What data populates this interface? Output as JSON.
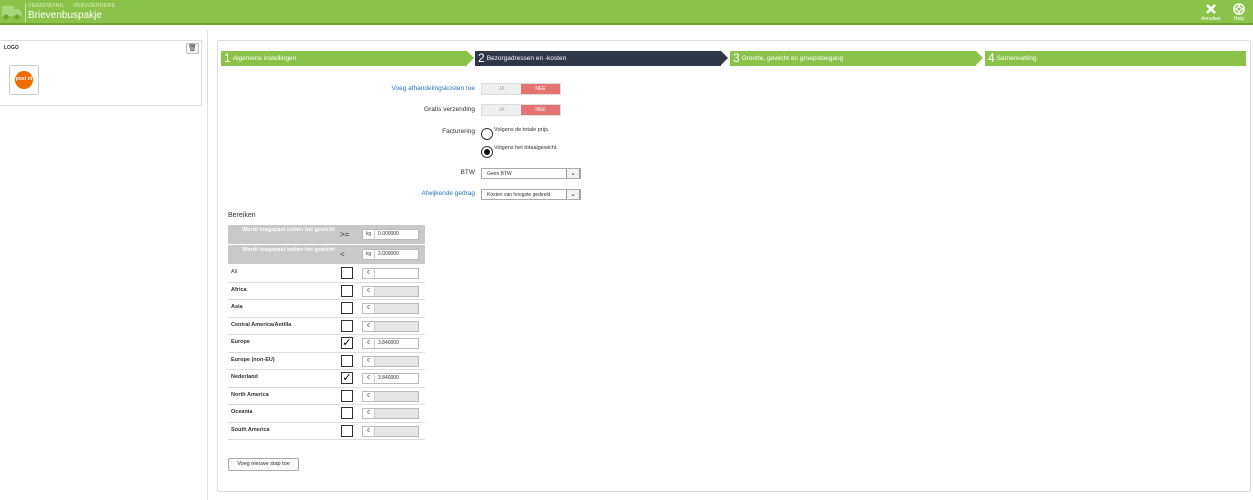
{
  "header": {
    "crumbs": [
      "VERZENDING",
      "VERVOERDERS"
    ],
    "title": "Brievenbuspakje",
    "cancel_label": "Annuleer",
    "help_label": "Help",
    "color": "#8bc34a"
  },
  "sidebar": {
    "logo_label": "LOGO",
    "logo_text": "post nl"
  },
  "steps": [
    {
      "num": "1",
      "label": "Algemene instellingen",
      "active": false
    },
    {
      "num": "2",
      "label": "Bezorgadressen en -kosten",
      "active": true
    },
    {
      "num": "3",
      "label": "Grootte, gewicht en groepstoegang",
      "active": false
    },
    {
      "num": "4",
      "label": "Samenvatting",
      "active": false
    }
  ],
  "form": {
    "handling": {
      "label": "Voeg afhandelingskosten toe",
      "yes": "JA",
      "no": "NEE",
      "value": "NEE"
    },
    "free_shipping": {
      "label": "Gratis verzending",
      "yes": "JA",
      "no": "NEE",
      "value": "NEE"
    },
    "billing": {
      "label": "Facturering",
      "options": [
        "Volgens de totale prijs.",
        "Volgens het totaalgewicht."
      ],
      "selected": "Volgens het totaalgewicht."
    },
    "vat": {
      "label": "BTW",
      "value": "Geen BTW"
    },
    "behavior": {
      "label": "Afwijkende gedrag",
      "value": "Kosten van hoogste gedeeld"
    }
  },
  "ranges": {
    "title": "Bereiken",
    "header_rows": [
      {
        "label": "Wordt toegepast indien het gewicht",
        "operator": ">=",
        "unit": "kg",
        "value": "0.000000"
      },
      {
        "label": "Wordt toegepast indien het gewicht",
        "operator": "<",
        "unit": "kg",
        "value": "2.000000"
      }
    ],
    "currency": "€",
    "zones": [
      {
        "name": "All",
        "checked": false,
        "price": "",
        "enabled": true
      },
      {
        "name": "Africa",
        "checked": false,
        "price": "",
        "enabled": false
      },
      {
        "name": "Asia",
        "checked": false,
        "price": "",
        "enabled": false
      },
      {
        "name": "Central America/Antilla",
        "checked": false,
        "price": "",
        "enabled": false
      },
      {
        "name": "Europe",
        "checked": true,
        "price": "3.840000",
        "enabled": true
      },
      {
        "name": "Europe (non-EU)",
        "checked": false,
        "price": "",
        "enabled": false
      },
      {
        "name": "Nederland",
        "checked": true,
        "price": "3.840000",
        "enabled": true
      },
      {
        "name": "North America",
        "checked": false,
        "price": "",
        "enabled": false
      },
      {
        "name": "Oceania",
        "checked": false,
        "price": "",
        "enabled": false
      },
      {
        "name": "South America",
        "checked": false,
        "price": "",
        "enabled": false
      }
    ],
    "new_range_label": "Voeg nieuwe stap toe"
  }
}
